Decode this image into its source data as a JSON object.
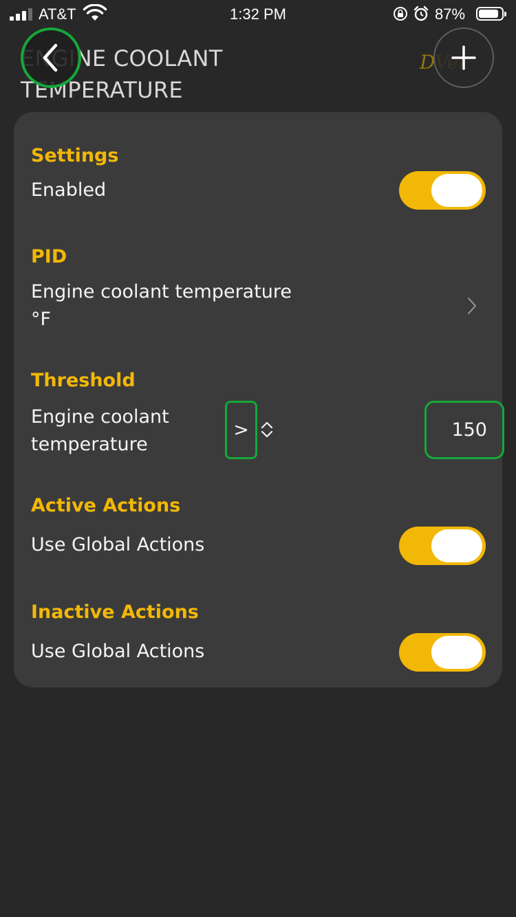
{
  "status_bar": {
    "carrier": "AT&T",
    "time": "1:32 PM",
    "battery_percent": "87%",
    "battery_level": 0.87,
    "icons": [
      "signal-icon",
      "wifi-icon",
      "orientation-lock-icon",
      "alarm-icon",
      "battery-icon"
    ]
  },
  "header": {
    "title": "ENGINE COOLANT TEMPERATURE",
    "back_icon": "chevron-left-icon",
    "add_icon": "plus-icon",
    "brand_logo": "DVer"
  },
  "settings": {
    "label": "Settings",
    "enabled_label": "Enabled",
    "enabled": true
  },
  "pid": {
    "label": "PID",
    "name": "Engine coolant temperature",
    "unit": "°F"
  },
  "threshold": {
    "label": "Threshold",
    "name_line1": "Engine coolant",
    "name_line2": "temperature",
    "operator": ">",
    "value": "150"
  },
  "active_actions": {
    "label": "Active Actions",
    "option_label": "Use Global Actions",
    "enabled": true
  },
  "inactive_actions": {
    "label": "Inactive Actions",
    "option_label": "Use Global Actions",
    "enabled": true
  },
  "colors": {
    "accent": "#f2b807",
    "background": "#282828",
    "card": "#3b3b3b",
    "highlight": "#15a83a"
  }
}
